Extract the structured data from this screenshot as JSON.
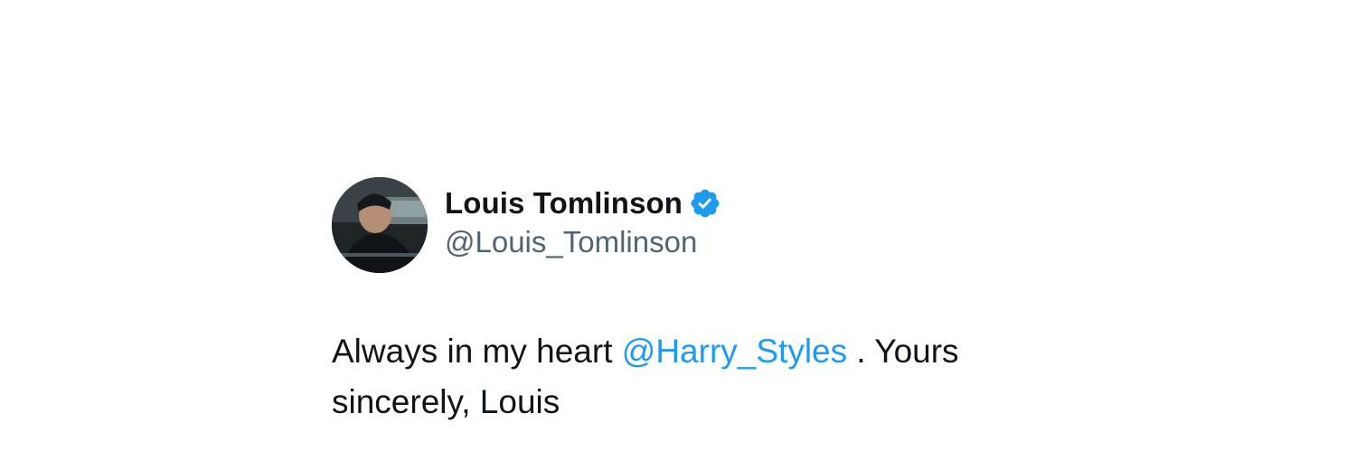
{
  "tweet": {
    "author": {
      "display_name": "Louis Tomlinson",
      "handle": "@Louis_Tomlinson",
      "verified": true,
      "verified_icon": "verified-badge-icon"
    },
    "text": {
      "prefix": "Always in my heart ",
      "mention": "@Harry_Styles",
      "suffix": " . Yours sincerely, Louis"
    }
  },
  "colors": {
    "text_primary": "#0f1419",
    "text_secondary": "#536471",
    "accent": "#1d9bf0"
  }
}
